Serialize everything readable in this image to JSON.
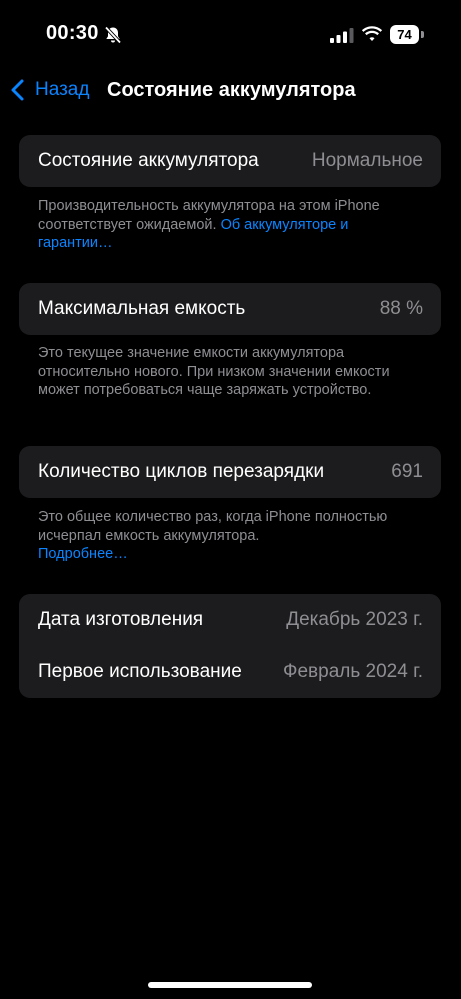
{
  "status_bar": {
    "time": "00:30",
    "battery_level": "74"
  },
  "nav": {
    "back_label": "Назад",
    "title": "Состояние аккумулятора"
  },
  "health": {
    "label": "Состояние аккумулятора",
    "value": "Нормальное",
    "footer_text": "Производительность аккумулятора на этом iPhone соответствует ожидаемой.",
    "footer_link": "Об аккумуляторе и гарантии…"
  },
  "capacity": {
    "label": "Максимальная емкость",
    "value": "88 %",
    "footer_text": "Это текущее значение емкости аккумулятора относительно нового. При низком значении емкости может потребоваться чаще заряжать устройство."
  },
  "cycles": {
    "label": "Количество циклов перезарядки",
    "value": "691",
    "footer_text": "Это общее количество раз, когда iPhone полностью исчерпал емкость аккумулятора.",
    "footer_link": "Подробнее…"
  },
  "dates": {
    "manufacture_label": "Дата изготовления",
    "manufacture_value": "Декабрь 2023 г.",
    "first_use_label": "Первое использование",
    "first_use_value": "Февраль 2024 г."
  },
  "colors": {
    "accent": "#0a84ff",
    "background": "#000000",
    "cell": "#1c1c1e",
    "secondary_text": "#8e8e93"
  }
}
